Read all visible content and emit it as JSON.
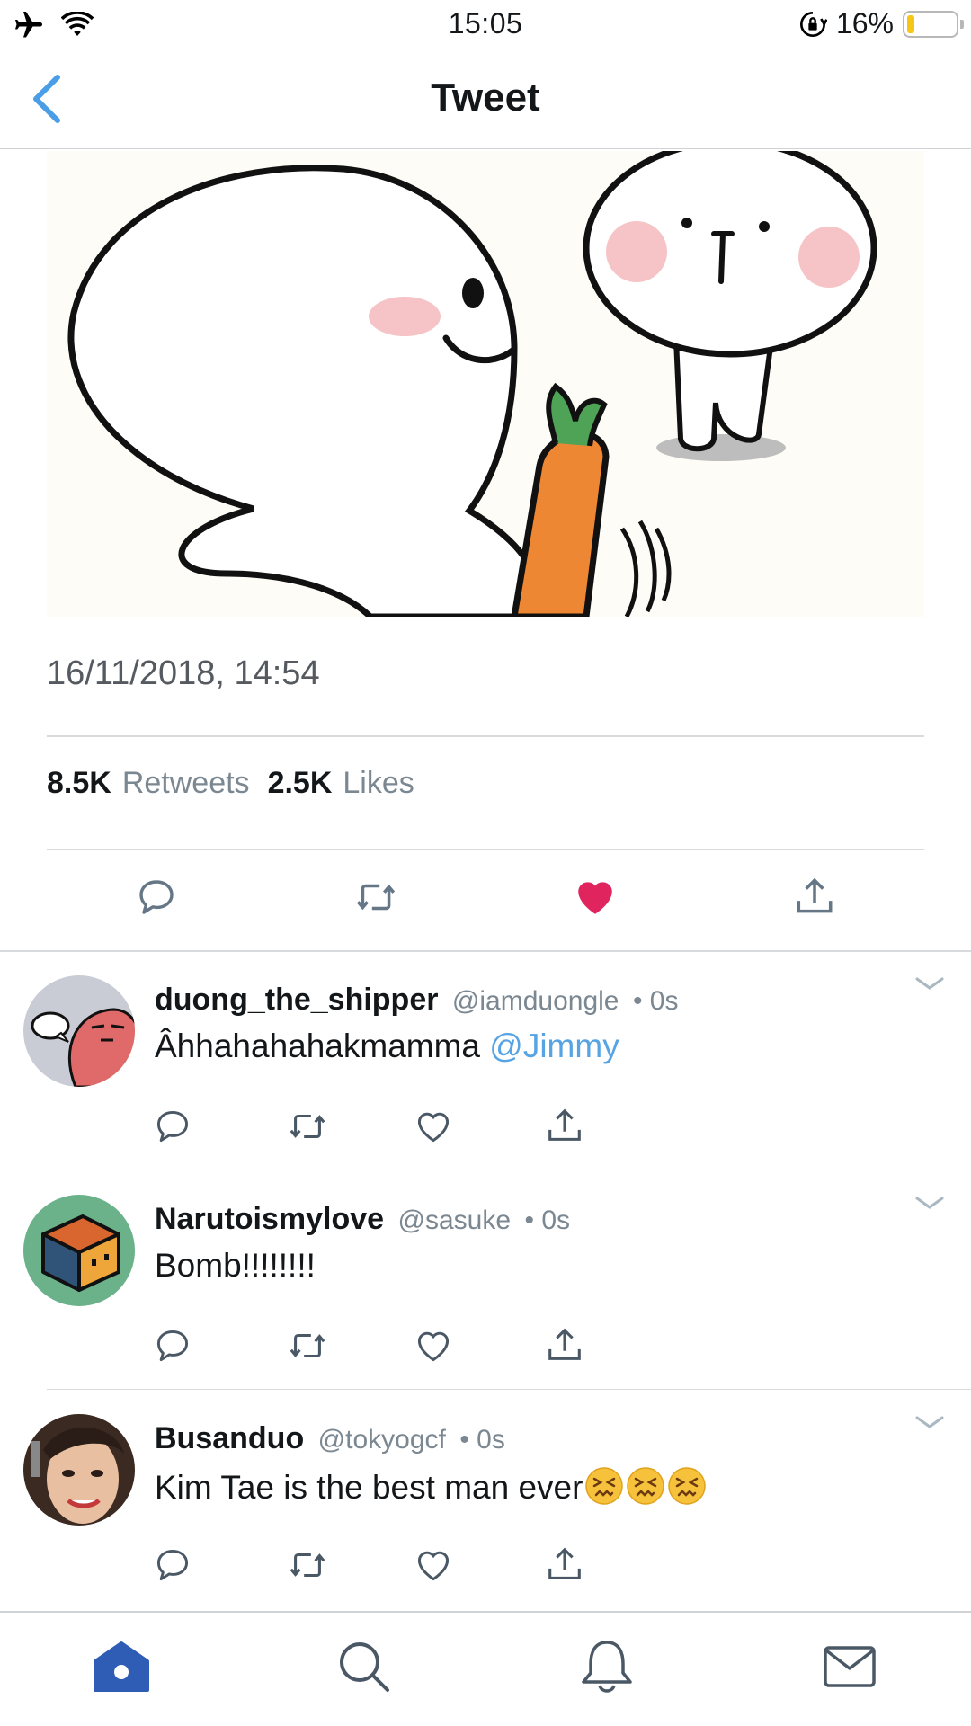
{
  "status_bar": {
    "time": "15:05",
    "battery_percent_label": "16%",
    "battery_level": 0.16,
    "icons": [
      "airplane-icon",
      "wifi-icon",
      "orientation-lock-icon",
      "battery-icon"
    ]
  },
  "nav": {
    "title": "Tweet",
    "back_icon": "chevron-left-icon"
  },
  "tweet": {
    "timestamp": "16/11/2018, 14:54",
    "retweets_count": "8.5K",
    "retweets_label": "Retweets",
    "likes_count": "2.5K",
    "likes_label": "Likes",
    "liked": true,
    "actions": [
      "reply-icon",
      "retweet-icon",
      "heart-filled-icon",
      "share-icon"
    ]
  },
  "replies": [
    {
      "name": "duong_the_shipper",
      "handle": "@iamduongle",
      "time": "• 0s",
      "text": "Âhhahahahakmamma",
      "mention": "@Jimmy"
    },
    {
      "name": "Narutoismylove",
      "handle": "@sasuke",
      "time": "• 0s",
      "text": "Bomb!!!!!!!!",
      "mention": ""
    },
    {
      "name": "Busanduo",
      "handle": "@tokyogcf",
      "time": "• 0s",
      "text": "Kim Tae is the best man ever",
      "mention": "",
      "emoji_count": 3,
      "emoji": "confounded-face"
    }
  ],
  "tab_bar": {
    "tabs": [
      "home-icon",
      "search-icon",
      "notifications-icon",
      "messages-icon"
    ],
    "active": "home-icon"
  },
  "colors": {
    "accent": "#1da1f2",
    "home_active": "#2f5db5",
    "like_red": "#e0245e",
    "mention_blue": "#57a4e4",
    "muted_text": "#7b8791"
  }
}
